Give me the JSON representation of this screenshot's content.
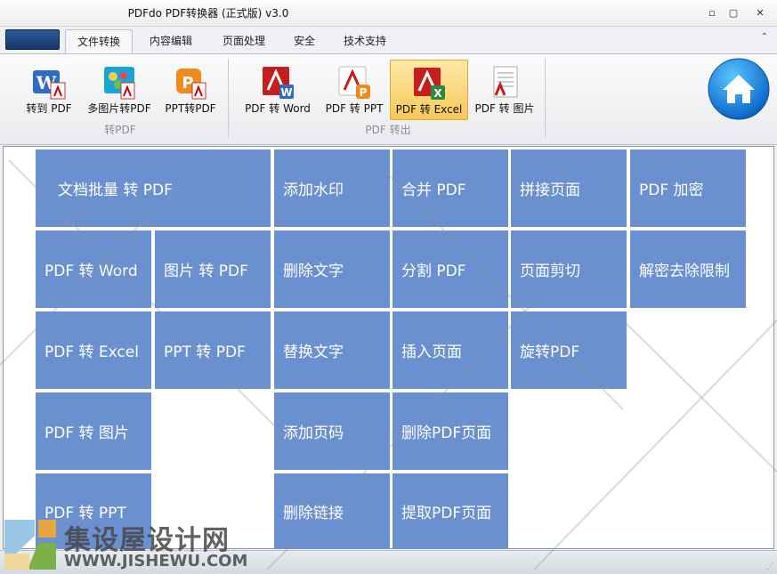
{
  "window": {
    "title": "PDFdo  PDF转换器  (正式版) v3.0",
    "minimize": "▫",
    "restore": "▢",
    "close": "✕"
  },
  "tabs": [
    {
      "label": "文件转换",
      "active": true
    },
    {
      "label": "内容编辑",
      "active": false
    },
    {
      "label": "页面处理",
      "active": false
    },
    {
      "label": "安全",
      "active": false
    },
    {
      "label": "技术支持",
      "active": false
    }
  ],
  "ribbon": {
    "groups": [
      {
        "label": "转PDF"
      },
      {
        "label": "PDF 转出"
      }
    ],
    "buttons": [
      {
        "label": "转到 PDF",
        "icon": "word-to-pdf-icon"
      },
      {
        "label": "多图片转PDF",
        "icon": "images-to-pdf-icon"
      },
      {
        "label": "PPT转PDF",
        "icon": "ppt-to-pdf-icon"
      },
      {
        "label": "PDF 转 Word",
        "icon": "pdf-to-word-icon"
      },
      {
        "label": "PDF 转 PPT",
        "icon": "pdf-to-ppt-icon"
      },
      {
        "label": "PDF 转 Excel",
        "icon": "pdf-to-excel-icon",
        "active": true
      },
      {
        "label": "PDF 转 图片",
        "icon": "pdf-to-image-icon"
      }
    ],
    "home_icon": "home-icon"
  },
  "tiles": [
    "文档批量 转 PDF",
    "添加水印",
    "合并 PDF",
    "拼接页面",
    "PDF 加密",
    "PDF 转 Word",
    "图片 转 PDF",
    "删除文字",
    "分割 PDF",
    "页面剪切",
    "解密去除限制",
    "PDF 转 Excel",
    "PPT 转 PDF",
    "替换文字",
    "插入页面",
    "旋转PDF",
    "PDF 转 图片",
    "添加页码",
    "删除PDF页面",
    "PDF 转 PPT",
    "删除链接",
    "提取PDF页面"
  ],
  "watermark": {
    "cn": "集设屋设计网",
    "en": "WWW.JISHEWU.COM"
  },
  "colors": {
    "tile": "#6b90cf",
    "accent": "#f9c85a"
  }
}
